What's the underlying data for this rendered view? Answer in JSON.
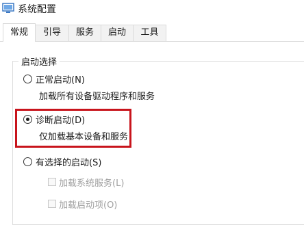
{
  "window": {
    "title": "系统配置",
    "icon": "system-config-icon"
  },
  "tabs": [
    {
      "label": "常规",
      "active": true
    },
    {
      "label": "引导",
      "active": false
    },
    {
      "label": "服务",
      "active": false
    },
    {
      "label": "启动",
      "active": false
    },
    {
      "label": "工具",
      "active": false
    }
  ],
  "startup_selection": {
    "group_label": "启动选择",
    "normal": {
      "label": "正常启动(N)",
      "description": "加载所有设备驱动程序和服务",
      "selected": false
    },
    "diagnostic": {
      "label": "诊断启动(D)",
      "description": "仅加载基本设备和服务",
      "selected": true
    },
    "selective": {
      "label": "有选择的启动(S)",
      "selected": false,
      "options": [
        {
          "label": "加载系统服务(L)",
          "checked": false,
          "enabled": false
        },
        {
          "label": "加载启动项(O)",
          "checked": false,
          "enabled": false
        }
      ]
    }
  },
  "colors": {
    "highlight_border": "#c8141c",
    "disabled_text": "#a0a0a0"
  }
}
